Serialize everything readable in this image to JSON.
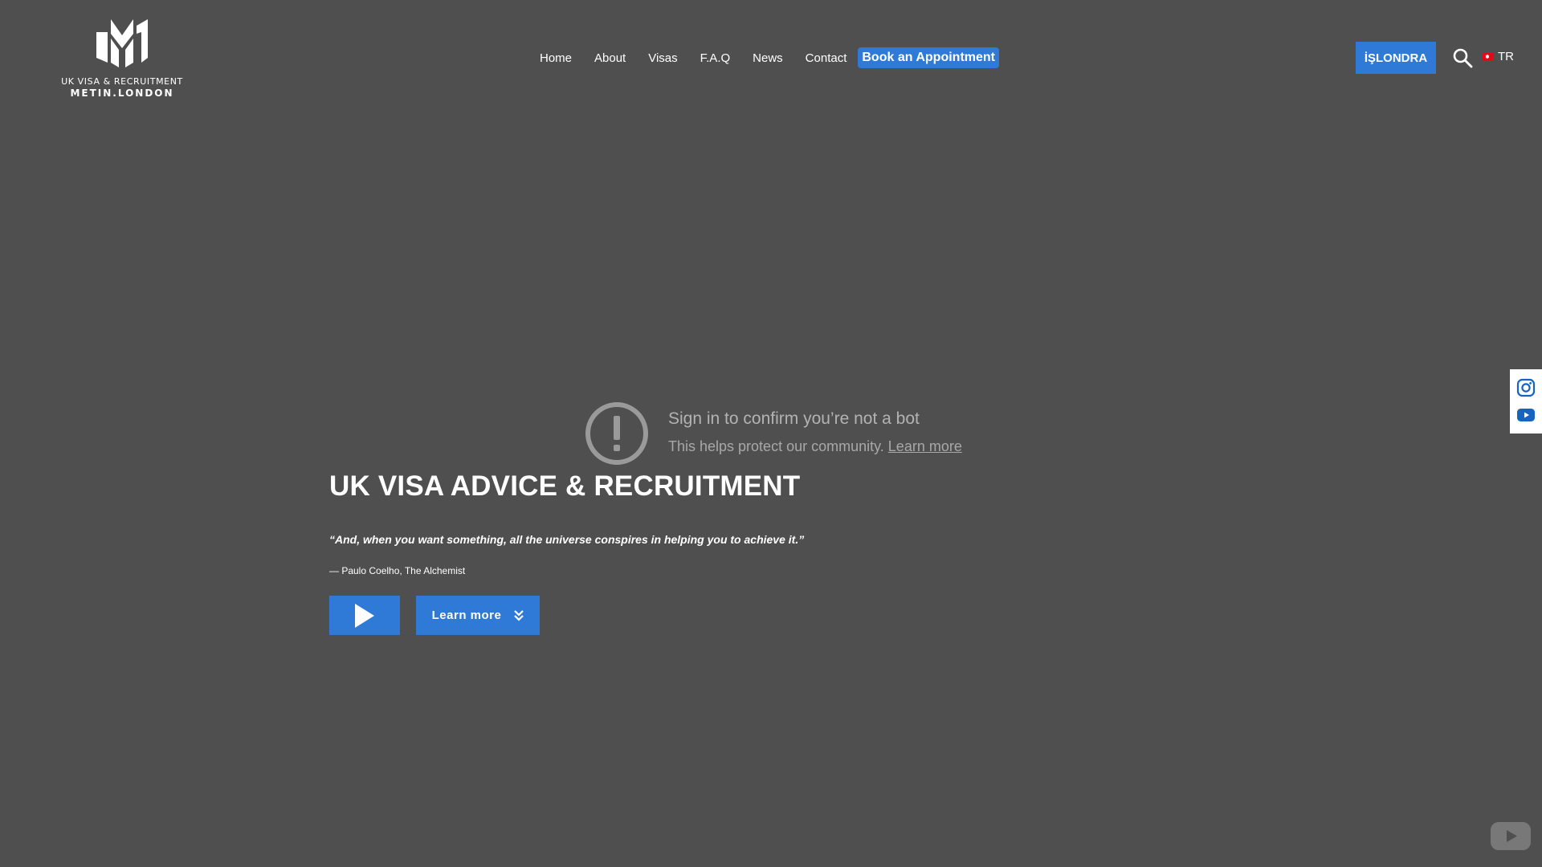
{
  "header": {
    "logo": {
      "line1": "UK VISA & RECRUITMENT",
      "line2": "METIN.LONDON"
    },
    "nav": [
      {
        "label": "Home"
      },
      {
        "label": "About"
      },
      {
        "label": "Visas"
      },
      {
        "label": "F.A.Q"
      },
      {
        "label": "News"
      },
      {
        "label": "Contact"
      }
    ],
    "cta_label": "Book an Appointment",
    "islondra_label": "İŞLONDRA",
    "language": {
      "code": "TR",
      "flag": "turkey-flag-icon"
    }
  },
  "bot_notice": {
    "title": "Sign in to confirm you’re not a bot",
    "subtitle": "This helps protect our community.",
    "link_label": "Learn more"
  },
  "hero": {
    "title": "UK VISA ADVICE & RECRUITMENT",
    "quote": "“And, when you want something, all the universe conspires in helping you to achieve it.”",
    "author": "— Paulo Coelho, The Alchemist",
    "learn_more_label": "Learn more"
  },
  "social": [
    {
      "name": "instagram-icon"
    },
    {
      "name": "youtube-icon"
    }
  ],
  "colors": {
    "background": "#4f4f4f",
    "accent": "#2e7ad6",
    "youtube_red": "#c4302b"
  }
}
